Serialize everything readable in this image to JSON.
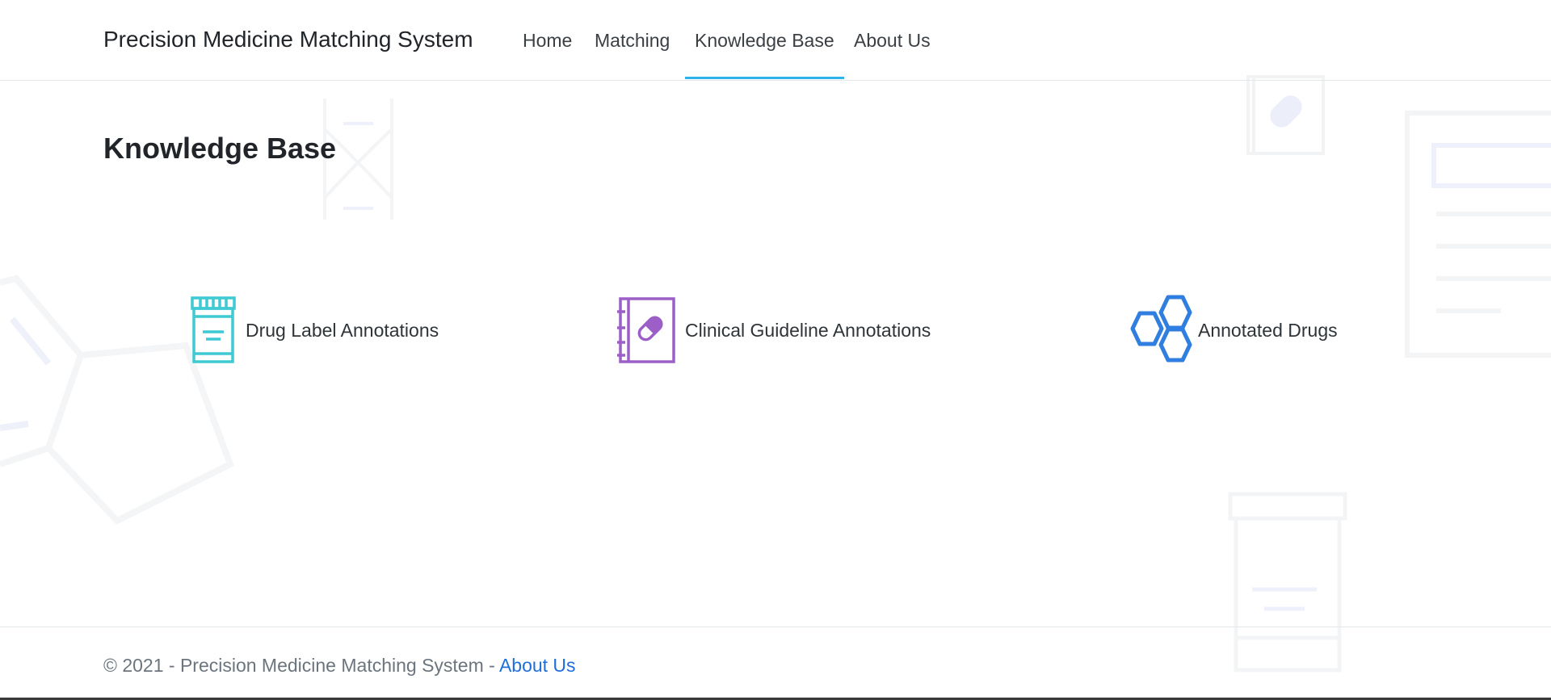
{
  "header": {
    "brand": "Precision Medicine Matching System",
    "nav": [
      {
        "label": "Home",
        "active": false
      },
      {
        "label": "Matching",
        "active": false
      },
      {
        "label": "Knowledge Base",
        "active": true
      },
      {
        "label": "About Us",
        "active": false
      }
    ]
  },
  "main": {
    "title": "Knowledge Base",
    "cards": [
      {
        "label": "Drug Label Annotations",
        "icon": "pill-bottle-icon",
        "color": "#3ec9d3"
      },
      {
        "label": "Clinical Guideline Annotations",
        "icon": "guideline-book-icon",
        "color": "#9c5fc7"
      },
      {
        "label": "Annotated Drugs",
        "icon": "hexagon-molecule-icon",
        "color": "#2f7ee0"
      }
    ]
  },
  "footer": {
    "text": "© 2021 - Precision Medicine Matching System - ",
    "link": "About Us"
  },
  "colors": {
    "active_underline": "#2bb3ea",
    "footer_link": "#1e6fd9"
  }
}
